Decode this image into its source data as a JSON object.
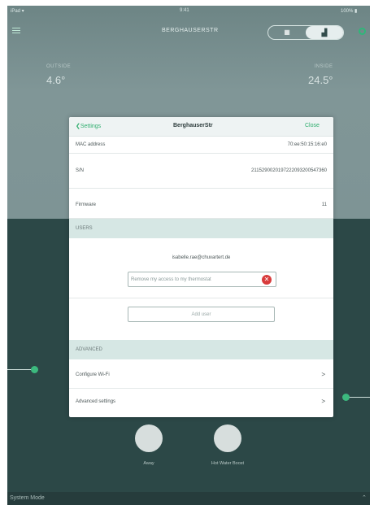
{
  "statusbar": {
    "left": "iPad ▾",
    "time": "9:41",
    "battery": "100% ▮"
  },
  "navbar": {
    "title": "BERGHAUSERSTR",
    "pill_left": "▦",
    "pill_right": "▟"
  },
  "temps": {
    "left_label": "OUTSIDE",
    "left_value": "4.6°",
    "right_label": "INSIDE",
    "right_value": "24.5°"
  },
  "modal": {
    "back_label": "Settings",
    "title": "BerghauserStr",
    "close_label": "Close",
    "rows": [
      {
        "key": "MAC address",
        "value": "70:ee:50:15:16:e0"
      },
      {
        "key": "S/N",
        "value": "2115290020197222093200547360"
      },
      {
        "key": "Firmware",
        "value": "11"
      }
    ],
    "users_section": "USERS",
    "user_email": "isabelle.rae@chuvartert.de",
    "remove_text": "Remove my access to my thermostat",
    "add_user_label": "Add user",
    "advanced_section": "ADVANCED",
    "advanced_items": [
      {
        "label": "Configure Wi-Fi",
        "chevron": ">"
      },
      {
        "label": "Advanced settings",
        "chevron": ">"
      }
    ]
  },
  "bottom": {
    "away_label": "Away",
    "hot_label": "Hot Water Boost"
  },
  "system_bar": {
    "label": "System Mode",
    "chevron": "⌃"
  }
}
